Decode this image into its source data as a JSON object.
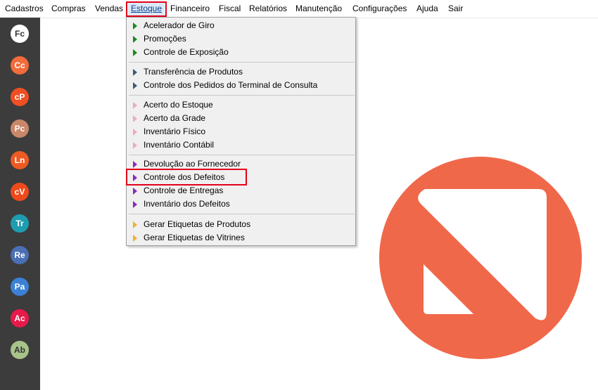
{
  "menubar": {
    "items": [
      "Cadastros",
      "Compras",
      "Vendas",
      "Estoque",
      "Financeiro",
      "Fiscal",
      "Relatórios",
      "Manutenção",
      "Configurações",
      "Ajuda",
      "Sair"
    ]
  },
  "sidebar": {
    "buttons": [
      {
        "label": "Fc",
        "color": "#ffffff",
        "text_color": "#333333"
      },
      {
        "label": "Cc",
        "color": "#f26b3a"
      },
      {
        "label": "cP",
        "color": "#f04e23"
      },
      {
        "label": "Pc",
        "color": "#c9876a"
      },
      {
        "label": "Ln",
        "color": "#ee5a24"
      },
      {
        "label": "cV",
        "color": "#ee4a1c"
      },
      {
        "label": "Tr",
        "color": "#1e9cb0"
      },
      {
        "label": "Re",
        "color": "#4a6fb5"
      },
      {
        "label": "Pa",
        "color": "#3b82d6"
      },
      {
        "label": "Ac",
        "color": "#e8194b"
      },
      {
        "label": "Ab",
        "color": "#a8c48a",
        "text_color": "#333333"
      }
    ]
  },
  "dropdown": {
    "items": [
      {
        "label": "Acelerador de Giro",
        "arrow_color": "#1a8a1a"
      },
      {
        "label": "Promoções",
        "arrow_color": "#1a8a1a"
      },
      {
        "label": "Controle de Exposição",
        "arrow_color": "#1a8a1a"
      },
      {
        "label": "Transferência de Produtos",
        "arrow_color": "#3c5a78"
      },
      {
        "label": "Controle dos Pedidos do Terminal de Consulta",
        "arrow_color": "#3c5a78"
      },
      {
        "label": "Acerto do Estoque",
        "arrow_color": "#f0a8c8"
      },
      {
        "label": "Acerto da Grade",
        "arrow_color": "#f0a8c8"
      },
      {
        "label": "Inventário Físico",
        "arrow_color": "#f0a8c8"
      },
      {
        "label": "Inventário Contábil",
        "arrow_color": "#f0a8c8"
      },
      {
        "label": "Devolução ao Fornecedor",
        "arrow_color": "#8a2ab8"
      },
      {
        "label": "Controle dos Defeitos",
        "arrow_color": "#8a2ab8"
      },
      {
        "label": "Controle de Entregas",
        "arrow_color": "#8a2ab8"
      },
      {
        "label": "Inventário dos Defeitos",
        "arrow_color": "#8a2ab8"
      },
      {
        "label": "Gerar Etiquetas de Produtos",
        "arrow_color": "#f0b030"
      },
      {
        "label": "Gerar Etiquetas de Vitrines",
        "arrow_color": "#f0b030"
      }
    ]
  },
  "logo": {
    "color": "#f0684a"
  }
}
